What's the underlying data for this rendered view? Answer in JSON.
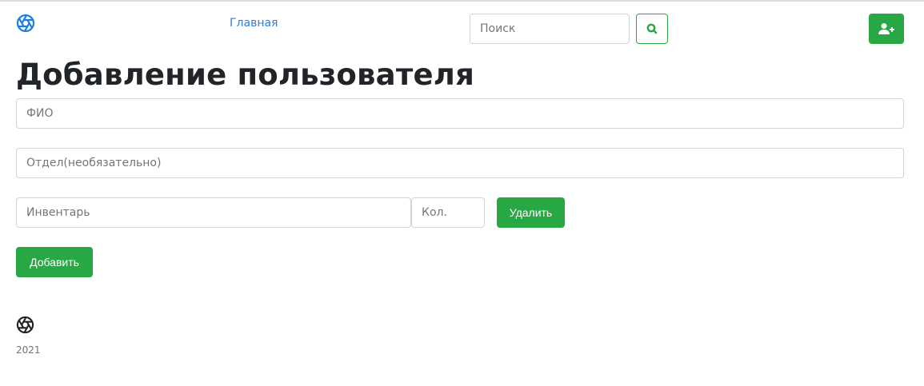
{
  "header": {
    "logo_icon": "aperture-icon",
    "nav_home": "Главная",
    "search_placeholder": "Поиск",
    "search_icon": "search-icon",
    "add_user_icon": "user-plus-icon"
  },
  "page": {
    "title": "Добавление пользователя"
  },
  "form": {
    "fio_placeholder": "ФИО",
    "department_placeholder": "Отдел(необязательно)",
    "inventory_placeholder": "Инвентарь",
    "quantity_placeholder": "Кол.",
    "delete_label": "Удалить",
    "add_label": "Добавить"
  },
  "footer": {
    "logo_icon": "aperture-icon",
    "year": "2021"
  },
  "colors": {
    "accent": "#28a745",
    "link": "#2f7fd1",
    "logo": "#1a7fe0"
  }
}
